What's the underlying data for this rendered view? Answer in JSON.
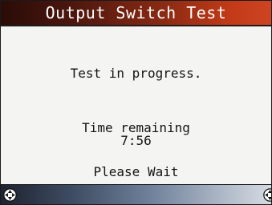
{
  "screen": {
    "title": "Output Switch Test",
    "message": "Test in progress.",
    "time_label": "Time remaining",
    "time_value": "7:56",
    "footer_message": "Please Wait"
  },
  "status_bar": {
    "left_icon": "navigation-pad-icon",
    "right_icon": "navigation-pad-icon"
  },
  "colors": {
    "title_bar_start": "#2a0c08",
    "title_bar_end": "#cc4420",
    "status_bar_start": "#1e2330",
    "status_bar_end": "#d6dbe2",
    "background": "#f4f4f2"
  }
}
